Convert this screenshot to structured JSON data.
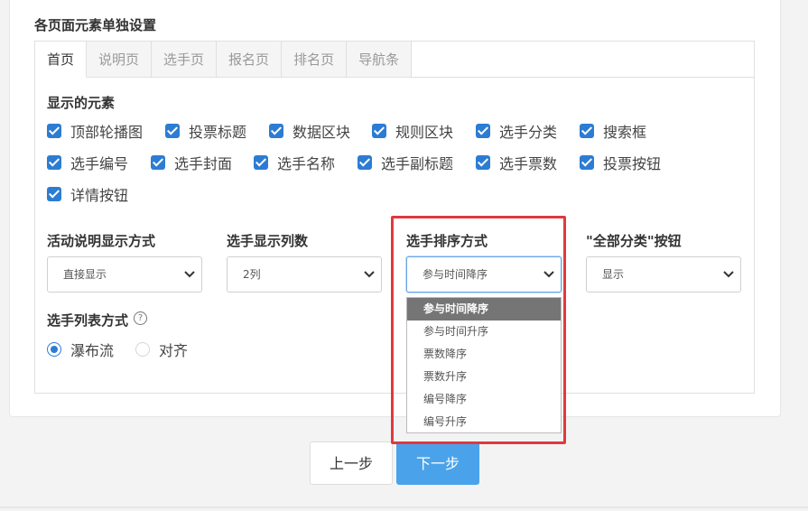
{
  "section_title": "各页面元素单独设置",
  "tabs": [
    {
      "label": "首页",
      "active": true
    },
    {
      "label": "说明页"
    },
    {
      "label": "选手页"
    },
    {
      "label": "报名页"
    },
    {
      "label": "排名页"
    },
    {
      "label": "导航条"
    }
  ],
  "elements_label": "显示的元素",
  "checkboxes": [
    {
      "label": "顶部轮播图",
      "checked": true
    },
    {
      "label": "投票标题",
      "checked": true
    },
    {
      "label": "数据区块",
      "checked": true
    },
    {
      "label": "规则区块",
      "checked": true
    },
    {
      "label": "选手分类",
      "checked": true
    },
    {
      "label": "搜索框",
      "checked": true
    },
    {
      "label": "选手编号",
      "checked": true
    },
    {
      "label": "选手封面",
      "checked": true
    },
    {
      "label": "选手名称",
      "checked": true
    },
    {
      "label": "选手副标题",
      "checked": true
    },
    {
      "label": "选手票数",
      "checked": true
    },
    {
      "label": "投票按钮",
      "checked": true
    },
    {
      "label": "详情按钮",
      "checked": true
    }
  ],
  "settings": [
    {
      "label": "活动说明显示方式",
      "value": "直接显示"
    },
    {
      "label": "选手显示列数",
      "value": "2列"
    },
    {
      "label": "选手排序方式",
      "value": "参与时间降序"
    },
    {
      "label": "\"全部分类\"按钮",
      "value": "显示"
    }
  ],
  "sort_options": [
    "参与时间降序",
    "参与时间升序",
    "票数降序",
    "票数升序",
    "编号降序",
    "编号升序"
  ],
  "list_mode_label": "选手列表方式",
  "list_modes": [
    {
      "label": "瀑布流",
      "selected": true
    },
    {
      "label": "对齐",
      "selected": false
    }
  ],
  "help_glyph": "?",
  "buttons": {
    "prev": "上一步",
    "next": "下一步"
  },
  "colors": {
    "accent": "#2d7cd3",
    "next_button": "#4aa3ea",
    "highlight": "#e0393e"
  }
}
